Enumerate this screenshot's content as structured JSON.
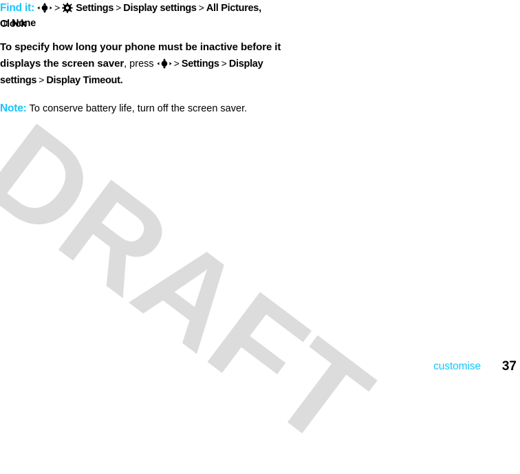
{
  "page": {
    "watermark_text": "DRAFT",
    "watermark_color": "#dcdcdc",
    "accent_color": "#17c4fb",
    "background_color": "#ffffff"
  },
  "find_it": {
    "label": "Find it:",
    "separator": ">",
    "nav_icon": "five-way-navigation-key-icon",
    "settings_icon": "settings-gear-icon",
    "path": [
      {
        "label": "Settings",
        "style": "ui-path"
      },
      {
        "label": "Display settings",
        "style": "ui-path"
      },
      {
        "label": "All Pictures, Clock",
        "style": "ui-path"
      }
    ],
    "line2_prefix": "or",
    "line2_value": "None"
  },
  "instruction": {
    "bold_lead": "To specify how long your phone must be inactive before it displays the screen saver",
    "comma": ",",
    "press_word": "press",
    "nav_icon": "five-way-navigation-key-icon",
    "separator": ">",
    "path": [
      {
        "label": "Settings"
      },
      {
        "label": "Display settings"
      },
      {
        "label": "Display Timeout"
      }
    ],
    "period": "."
  },
  "note": {
    "label": "Note:",
    "text": "To conserve battery life, turn off the screen saver."
  },
  "footer": {
    "section": "customise",
    "page_number": "37"
  }
}
